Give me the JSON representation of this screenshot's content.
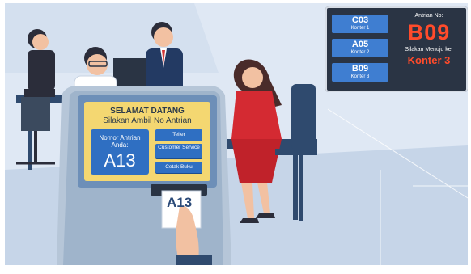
{
  "queue_board": {
    "tiles": [
      {
        "code": "C03",
        "counter": "Konter 1"
      },
      {
        "code": "A05",
        "counter": "Konter 2"
      },
      {
        "code": "B09",
        "counter": "Konter 3"
      }
    ],
    "label": "Antrian No:",
    "current_number": "B09",
    "go_to_label": "Silakan Menuju ke:",
    "go_to_counter": "Konter 3"
  },
  "kiosk": {
    "title": "SELAMAT DATANG",
    "subtitle": "Silakan Ambil No Antrian",
    "panel_line1": "Nomor Antrian",
    "panel_line2": "Anda:",
    "number": "A13",
    "buttons": [
      "Teller",
      "Customer Service",
      "Cetak Buku"
    ]
  },
  "ticket": {
    "number": "A13"
  },
  "colors": {
    "accent_blue": "#3f7ed1",
    "alert_red": "#ff4b2b",
    "screen_yellow": "#f4d771"
  }
}
